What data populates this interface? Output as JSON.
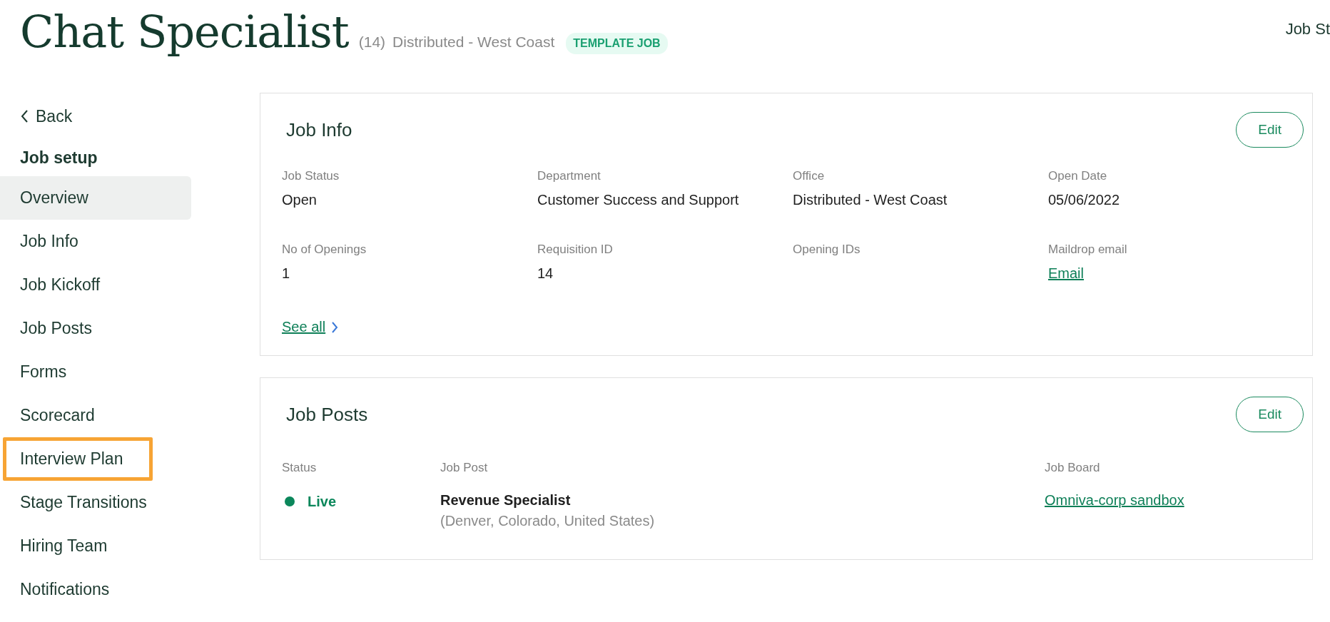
{
  "header": {
    "title": "Chat Specialist",
    "count": "(14)",
    "location": "Distributed - West Coast",
    "badge": "TEMPLATE JOB",
    "right_text": "Job St"
  },
  "sidebar": {
    "back": "Back",
    "section": "Job setup",
    "items": [
      {
        "label": "Overview",
        "selected": true,
        "highlighted": false
      },
      {
        "label": "Job Info",
        "selected": false,
        "highlighted": false
      },
      {
        "label": "Job Kickoff",
        "selected": false,
        "highlighted": false
      },
      {
        "label": "Job Posts",
        "selected": false,
        "highlighted": false
      },
      {
        "label": "Forms",
        "selected": false,
        "highlighted": false
      },
      {
        "label": "Scorecard",
        "selected": false,
        "highlighted": false
      },
      {
        "label": "Interview Plan",
        "selected": false,
        "highlighted": true
      },
      {
        "label": "Stage Transitions",
        "selected": false,
        "highlighted": false
      },
      {
        "label": "Hiring Team",
        "selected": false,
        "highlighted": false
      },
      {
        "label": "Notifications",
        "selected": false,
        "highlighted": false
      }
    ]
  },
  "job_info": {
    "title": "Job Info",
    "edit": "Edit",
    "fields": [
      {
        "label": "Job Status",
        "value": "Open",
        "kind": "text"
      },
      {
        "label": "Department",
        "value": "Customer Success and Support",
        "kind": "text"
      },
      {
        "label": "Office",
        "value": "Distributed - West Coast",
        "kind": "text"
      },
      {
        "label": "Open Date",
        "value": "05/06/2022",
        "kind": "text"
      },
      {
        "label": "No of Openings",
        "value": "1",
        "kind": "text"
      },
      {
        "label": "Requisition ID",
        "value": "14",
        "kind": "text"
      },
      {
        "label": "Opening IDs",
        "kind": "empty"
      },
      {
        "label": "Maildrop email",
        "value": "Email",
        "kind": "link"
      }
    ],
    "see_all": "See all"
  },
  "job_posts": {
    "title": "Job Posts",
    "edit": "Edit",
    "columns": [
      "Status",
      "Job Post",
      "Job Board"
    ],
    "rows": [
      {
        "status": "Live",
        "color": "#0b875b",
        "post": "Revenue Specialist",
        "location": "(Denver, Colorado, United States)",
        "board": "Omniva-corp sandbox"
      }
    ]
  }
}
